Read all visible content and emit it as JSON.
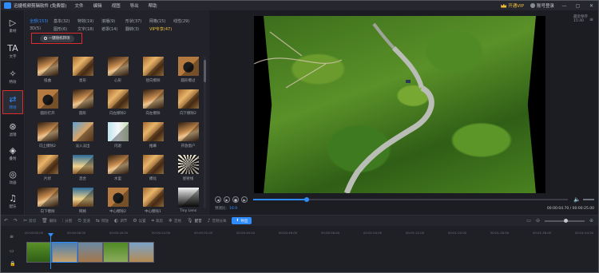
{
  "titlebar": {
    "app_title": "迅捷视频剪辑软件 (免费版)",
    "menu": [
      "文件",
      "编辑",
      "视图",
      "导出",
      "帮助"
    ],
    "vip_label": "开通VIP",
    "login_label": "账号登录",
    "controls": [
      "—",
      "▢",
      "✕"
    ]
  },
  "sidebar": {
    "items": [
      {
        "label": "素材",
        "icon": "media-icon",
        "glyph": "▷"
      },
      {
        "label": "文字",
        "icon": "text-icon",
        "glyph": "TA"
      },
      {
        "label": "特效",
        "icon": "effects-icon",
        "glyph": "✧"
      },
      {
        "label": "转场",
        "icon": "transition-icon",
        "glyph": "⇄"
      },
      {
        "label": "滤镜",
        "icon": "filter-icon",
        "glyph": "⊛"
      },
      {
        "label": "叠附",
        "icon": "overlay-icon",
        "glyph": "◈"
      },
      {
        "label": "动画",
        "icon": "animation-icon",
        "glyph": "◎"
      },
      {
        "label": "配乐",
        "icon": "music-icon",
        "glyph": "♫"
      }
    ]
  },
  "panel": {
    "categories_row1": [
      "全部(153)",
      "基本(32)",
      "特效(19)",
      "滚播(9)",
      "形状(37)",
      "网格(15)",
      "线性(29)"
    ],
    "categories_row2": [
      "3D(5)",
      "图形(6)",
      "文字(18)",
      "遮罩(14)",
      "翻转(3)",
      "VIP专享(47)"
    ],
    "random_button": "一键随机转场",
    "transitions": [
      "扭曲",
      "星形",
      "心形",
      "径向擦除",
      "圆形擦过",
      "圆形打开",
      "圆形",
      "向左擦除2",
      "向左擦除",
      "向下擦除2",
      "向上擦除2",
      "淡入淡出",
      "闪退",
      "推幕",
      "开放窗户",
      "片状",
      "混合",
      "水里",
      "模化",
      "星射线",
      "向下擦除",
      "网格",
      "中心擦除2",
      "中心擦除1",
      "Tiny Lens"
    ]
  },
  "preview": {
    "ratio_label": "最近保存 15:40",
    "menu_glyph": "≡",
    "speed_label": "预测比:",
    "speed_value": "16:9",
    "timecode": "00:00:04.70 / 00:00:25.00",
    "progress": 0.17
  },
  "toolbar": {
    "tools": [
      "撤销",
      "重做",
      "剪切",
      "删除",
      "分割",
      "变速",
      "倒放",
      "调节",
      "设置",
      "裁剪",
      "定格",
      "配音"
    ],
    "active_tools": [
      "配音"
    ],
    "split_audio": "音频分离",
    "export_label": "导出"
  },
  "timeline": {
    "ticks": [
      "00:00:00.00",
      "00:00:08.00",
      "00:00:16.00",
      "00:00:24.00",
      "00:00:32.00",
      "00:00:40.00",
      "00:00:48.00",
      "00:00:56.00",
      "00:01:04.00",
      "00:01:12.00",
      "00:01:20.00",
      "00:01:28.00",
      "00:01:36.00",
      "00:01:44.00"
    ],
    "clip_count": 5,
    "selected_clip": 1
  },
  "colors": {
    "accent": "#2f8cff",
    "highlight": "#e02b2b",
    "vip": "#f3c13e",
    "background": "#1e1f25"
  }
}
